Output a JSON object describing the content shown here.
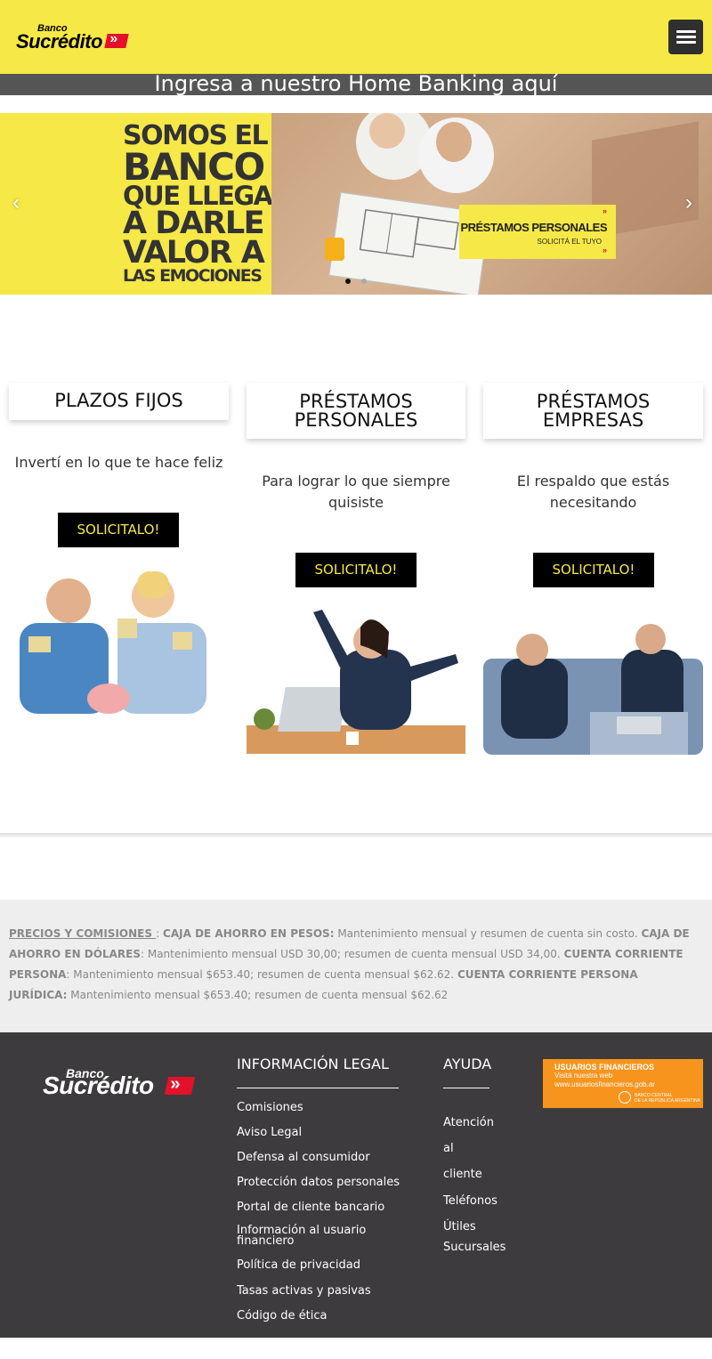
{
  "header": {
    "logo_small": "Banco",
    "logo_name": "Sucrédito",
    "logo_chevrons": "»",
    "menu_icon": "hamburger-menu-icon"
  },
  "home_banking": {
    "label": "Ingresa a nuestro Home Banking aquí"
  },
  "slider": {
    "headline_lines": [
      "SOMOS EL",
      "BANCO",
      "QUE LLEGA",
      "A DARLE",
      "VALOR A",
      "LAS EMOCIONES"
    ],
    "promo_title": "PRÉSTAMOS PERSONALES",
    "promo_sub": "SOLICITÁ EL TUYO",
    "promo_mark": "»",
    "prev_icon": "chevron-left-icon",
    "next_icon": "chevron-right-icon",
    "prev_glyph": "‹",
    "next_glyph": "›",
    "active_dot": 1,
    "dot_count": 2
  },
  "products": [
    {
      "title": "PLAZOS FIJOS",
      "description": "Invertí en lo que te hace feliz",
      "button": "SOLICITALO!"
    },
    {
      "title": "PRÉSTAMOS PERSONALES",
      "title_line1": "PRÉSTAMOS",
      "title_line2": "PERSONALES",
      "description": "Para lograr lo que siempre quisiste",
      "desc_line1": "Para lograr lo que siempre",
      "desc_line2": "quisiste",
      "button": "SOLICITALO!"
    },
    {
      "title": "PRÉSTAMOS EMPRESAS",
      "title_line1": "PRÉSTAMOS",
      "title_line2": "EMPRESAS",
      "description": "El respaldo que estás necesitando",
      "desc_line1": "El respaldo que estás",
      "desc_line2": "necesitando",
      "button": "SOLICITALO!"
    }
  ],
  "fees": {
    "link": "PRECIOS Y COMISIONES ",
    "sep": " : ",
    "caja_pesos_label": "CAJA DE AHORRO EN PESOS:",
    "caja_pesos_text": " Mantenimiento mensual y resumen de cuenta sin costo. ",
    "caja_dolares_label": "CAJA DE AHORRO EN DÓLARES",
    "caja_dolares_text": ": Mantenimiento mensual USD 30,00; resumen de cuenta mensual USD 34,00. ",
    "cc_persona_label": "CUENTA CORRIENTE PERSONA",
    "cc_persona_text": ": Mantenimiento mensual $653.40; resumen de cuenta mensual $62.62. ",
    "cc_juridica_label": "CUENTA CORRIENTE PERSONA JURÍDICA:",
    "cc_juridica_text": " Mantenimiento mensual $653.40; resumen de cuenta mensual $62.62"
  },
  "footer": {
    "logo_small": "Banco",
    "logo_name": "Sucrédito",
    "logo_chevrons": "»",
    "legal_heading": "INFORMACIÓN LEGAL",
    "legal_links": [
      "Comisiones",
      "Aviso Legal",
      "Defensa al consumidor",
      "Protección datos personales",
      "Portal de cliente bancario",
      "Información al usuario financiero",
      "Política de privacidad",
      "Tasas activas y pasivas",
      "Código de ética"
    ],
    "info_user_line1": "Información al usuario",
    "info_user_line2": "financiero",
    "help_heading": "AYUDA",
    "help_links": [
      "Atención al cliente",
      "Teléfonos Útiles",
      "Sucursales"
    ],
    "help_lines": [
      "Atención",
      "al",
      "cliente",
      "Teléfonos",
      "Útiles",
      "Sucursales"
    ],
    "badge_title": "USUARIOS FINANCIEROS",
    "badge_line1": "Visitá nuestra web",
    "badge_line2": "www.usuariosfinancieros.gob.ar",
    "badge_seal_1": "BANCO CENTRAL",
    "badge_seal_2": "DE LA REPÚBLICA ARGENTINA"
  },
  "colors": {
    "brand_yellow": "#f6e846",
    "brand_red": "#e4112b",
    "dark": "#3d3b3d",
    "badge_orange": "#f7941d"
  }
}
